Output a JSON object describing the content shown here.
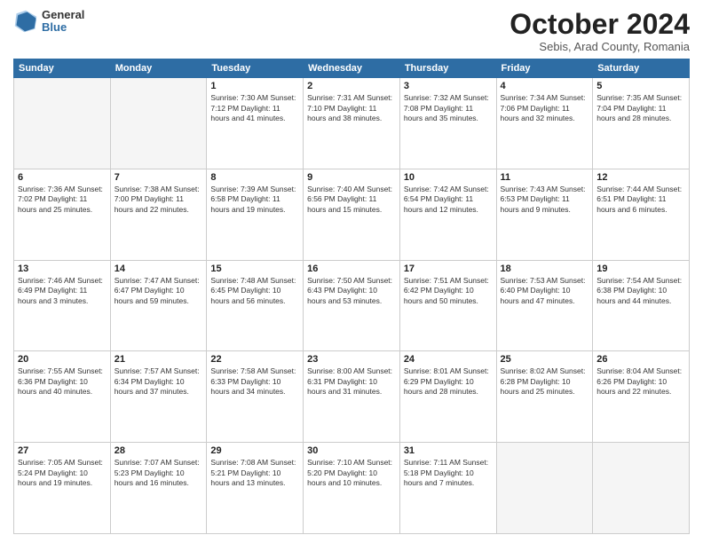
{
  "header": {
    "logo_general": "General",
    "logo_blue": "Blue",
    "month_title": "October 2024",
    "location": "Sebis, Arad County, Romania"
  },
  "calendar": {
    "days_of_week": [
      "Sunday",
      "Monday",
      "Tuesday",
      "Wednesday",
      "Thursday",
      "Friday",
      "Saturday"
    ],
    "weeks": [
      [
        {
          "day": "",
          "info": ""
        },
        {
          "day": "",
          "info": ""
        },
        {
          "day": "1",
          "info": "Sunrise: 7:30 AM\nSunset: 7:12 PM\nDaylight: 11 hours and 41 minutes."
        },
        {
          "day": "2",
          "info": "Sunrise: 7:31 AM\nSunset: 7:10 PM\nDaylight: 11 hours and 38 minutes."
        },
        {
          "day": "3",
          "info": "Sunrise: 7:32 AM\nSunset: 7:08 PM\nDaylight: 11 hours and 35 minutes."
        },
        {
          "day": "4",
          "info": "Sunrise: 7:34 AM\nSunset: 7:06 PM\nDaylight: 11 hours and 32 minutes."
        },
        {
          "day": "5",
          "info": "Sunrise: 7:35 AM\nSunset: 7:04 PM\nDaylight: 11 hours and 28 minutes."
        }
      ],
      [
        {
          "day": "6",
          "info": "Sunrise: 7:36 AM\nSunset: 7:02 PM\nDaylight: 11 hours and 25 minutes."
        },
        {
          "day": "7",
          "info": "Sunrise: 7:38 AM\nSunset: 7:00 PM\nDaylight: 11 hours and 22 minutes."
        },
        {
          "day": "8",
          "info": "Sunrise: 7:39 AM\nSunset: 6:58 PM\nDaylight: 11 hours and 19 minutes."
        },
        {
          "day": "9",
          "info": "Sunrise: 7:40 AM\nSunset: 6:56 PM\nDaylight: 11 hours and 15 minutes."
        },
        {
          "day": "10",
          "info": "Sunrise: 7:42 AM\nSunset: 6:54 PM\nDaylight: 11 hours and 12 minutes."
        },
        {
          "day": "11",
          "info": "Sunrise: 7:43 AM\nSunset: 6:53 PM\nDaylight: 11 hours and 9 minutes."
        },
        {
          "day": "12",
          "info": "Sunrise: 7:44 AM\nSunset: 6:51 PM\nDaylight: 11 hours and 6 minutes."
        }
      ],
      [
        {
          "day": "13",
          "info": "Sunrise: 7:46 AM\nSunset: 6:49 PM\nDaylight: 11 hours and 3 minutes."
        },
        {
          "day": "14",
          "info": "Sunrise: 7:47 AM\nSunset: 6:47 PM\nDaylight: 10 hours and 59 minutes."
        },
        {
          "day": "15",
          "info": "Sunrise: 7:48 AM\nSunset: 6:45 PM\nDaylight: 10 hours and 56 minutes."
        },
        {
          "day": "16",
          "info": "Sunrise: 7:50 AM\nSunset: 6:43 PM\nDaylight: 10 hours and 53 minutes."
        },
        {
          "day": "17",
          "info": "Sunrise: 7:51 AM\nSunset: 6:42 PM\nDaylight: 10 hours and 50 minutes."
        },
        {
          "day": "18",
          "info": "Sunrise: 7:53 AM\nSunset: 6:40 PM\nDaylight: 10 hours and 47 minutes."
        },
        {
          "day": "19",
          "info": "Sunrise: 7:54 AM\nSunset: 6:38 PM\nDaylight: 10 hours and 44 minutes."
        }
      ],
      [
        {
          "day": "20",
          "info": "Sunrise: 7:55 AM\nSunset: 6:36 PM\nDaylight: 10 hours and 40 minutes."
        },
        {
          "day": "21",
          "info": "Sunrise: 7:57 AM\nSunset: 6:34 PM\nDaylight: 10 hours and 37 minutes."
        },
        {
          "day": "22",
          "info": "Sunrise: 7:58 AM\nSunset: 6:33 PM\nDaylight: 10 hours and 34 minutes."
        },
        {
          "day": "23",
          "info": "Sunrise: 8:00 AM\nSunset: 6:31 PM\nDaylight: 10 hours and 31 minutes."
        },
        {
          "day": "24",
          "info": "Sunrise: 8:01 AM\nSunset: 6:29 PM\nDaylight: 10 hours and 28 minutes."
        },
        {
          "day": "25",
          "info": "Sunrise: 8:02 AM\nSunset: 6:28 PM\nDaylight: 10 hours and 25 minutes."
        },
        {
          "day": "26",
          "info": "Sunrise: 8:04 AM\nSunset: 6:26 PM\nDaylight: 10 hours and 22 minutes."
        }
      ],
      [
        {
          "day": "27",
          "info": "Sunrise: 7:05 AM\nSunset: 5:24 PM\nDaylight: 10 hours and 19 minutes."
        },
        {
          "day": "28",
          "info": "Sunrise: 7:07 AM\nSunset: 5:23 PM\nDaylight: 10 hours and 16 minutes."
        },
        {
          "day": "29",
          "info": "Sunrise: 7:08 AM\nSunset: 5:21 PM\nDaylight: 10 hours and 13 minutes."
        },
        {
          "day": "30",
          "info": "Sunrise: 7:10 AM\nSunset: 5:20 PM\nDaylight: 10 hours and 10 minutes."
        },
        {
          "day": "31",
          "info": "Sunrise: 7:11 AM\nSunset: 5:18 PM\nDaylight: 10 hours and 7 minutes."
        },
        {
          "day": "",
          "info": ""
        },
        {
          "day": "",
          "info": ""
        }
      ]
    ]
  }
}
